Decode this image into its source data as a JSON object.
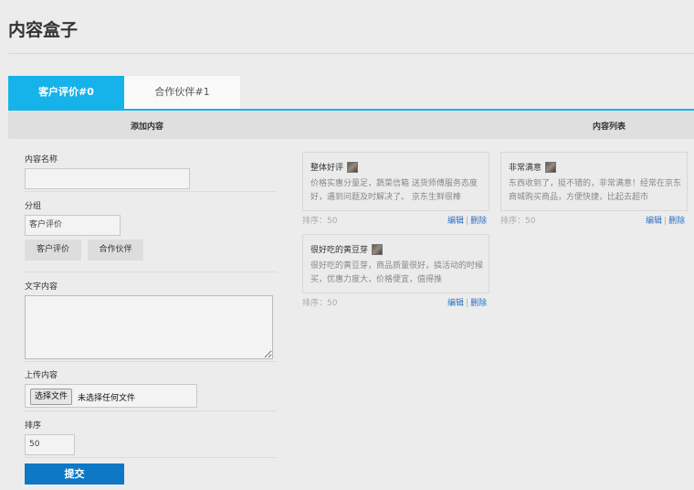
{
  "page": {
    "title": "内容盒子"
  },
  "tabs": [
    {
      "label": "客户评价#0",
      "active": true
    },
    {
      "label": "合作伙伴#1",
      "active": false
    }
  ],
  "header": {
    "left": "添加内容",
    "right": "内容列表"
  },
  "form": {
    "name_label": "内容名称",
    "name_value": "",
    "group_label": "分组",
    "group_value": "客户评价",
    "group_buttons": [
      "客户评价",
      "合作伙伴"
    ],
    "text_label": "文字内容",
    "upload_label": "上传内容",
    "file_button": "选择文件",
    "file_none": "未选择任何文件",
    "sort_label": "排序",
    "sort_value": "50",
    "submit": "提交"
  },
  "cards": [
    {
      "title": "整体好评",
      "body": "价格实惠分量足，蔬菜信箱 送货师傅服务态度好，遇到问题及时解决了。 京东生鲜很棒",
      "sort": "排序：50",
      "edit": "编辑",
      "delete": "删除"
    },
    {
      "title": "非常满意",
      "body": "东西收到了，挺不错的，非常满意！经常在京东商城购买商品，方便快捷，比起去超市",
      "sort": "排序：50",
      "edit": "编辑",
      "delete": "删除"
    },
    {
      "title": "很好吃的黄豆芽",
      "body": "很好吃的黄豆芽，商品质量很好，搞活动的时候买，优惠力度大，价格便宜，值得推",
      "sort": "排序：50",
      "edit": "编辑",
      "delete": "删除"
    }
  ],
  "colors": {
    "accent": "#16b2ea",
    "primary_button": "#0f78c4",
    "link": "#2a72c6"
  }
}
